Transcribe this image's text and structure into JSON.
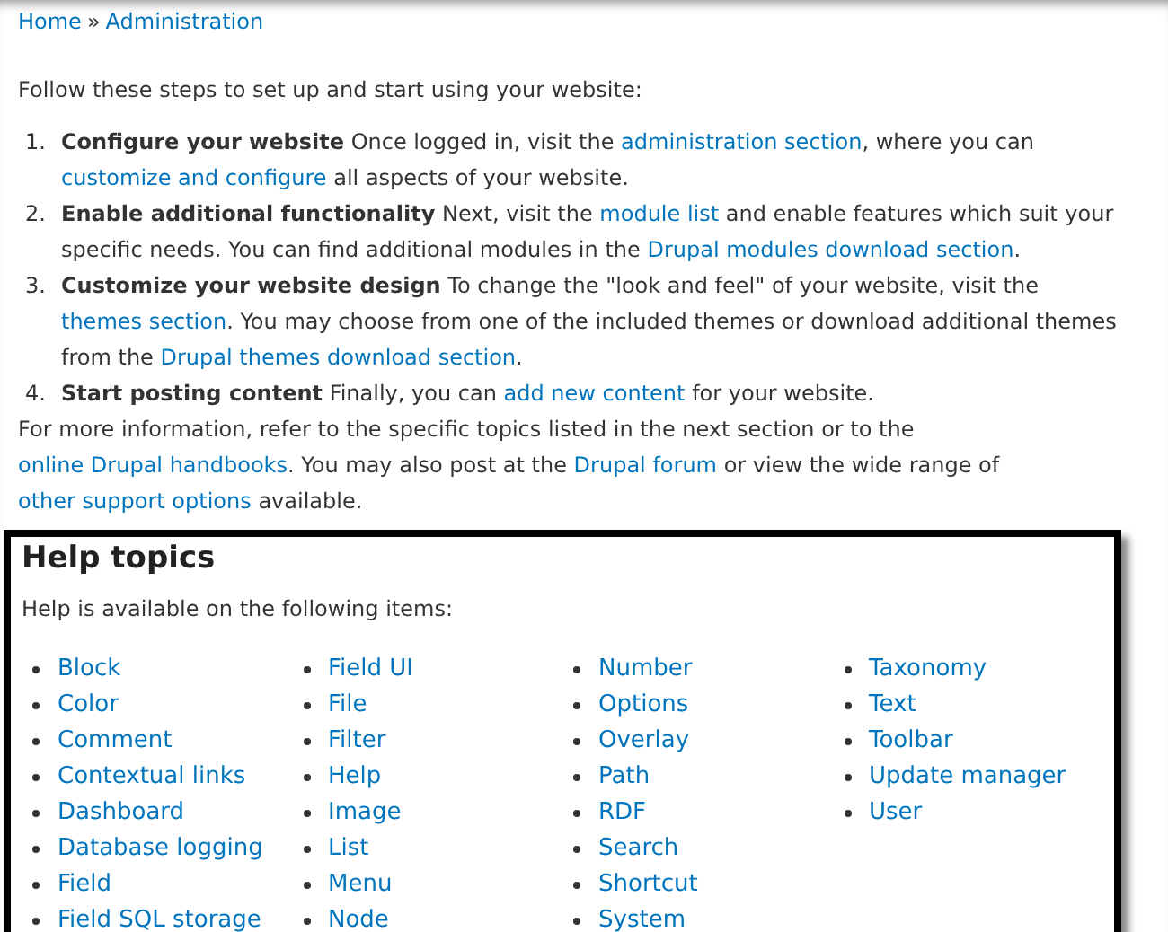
{
  "breadcrumb": [
    {
      "label": "Home",
      "kind": "link"
    },
    {
      "label": "»",
      "kind": "text"
    },
    {
      "label": "Administration",
      "kind": "link"
    }
  ],
  "intro": "Follow these steps to set up and start using your website:",
  "steps": [
    {
      "number": "1.",
      "segments": [
        {
          "kind": "bold",
          "text": "Configure your website"
        },
        {
          "kind": "text",
          "text": " Once logged in, visit the "
        },
        {
          "kind": "link",
          "text": "administration section"
        },
        {
          "kind": "text",
          "text": ", where you can "
        },
        {
          "kind": "link",
          "text": "customize and configure"
        },
        {
          "kind": "text",
          "text": " all aspects of your website."
        }
      ]
    },
    {
      "number": "2.",
      "segments": [
        {
          "kind": "bold",
          "text": "Enable additional functionality"
        },
        {
          "kind": "text",
          "text": " Next, visit the "
        },
        {
          "kind": "link",
          "text": "module list"
        },
        {
          "kind": "text",
          "text": " and enable features which suit your specific needs. You can find additional modules in the "
        },
        {
          "kind": "link",
          "text": "Drupal modules download section"
        },
        {
          "kind": "text",
          "text": "."
        }
      ]
    },
    {
      "number": "3.",
      "segments": [
        {
          "kind": "bold",
          "text": "Customize your website design"
        },
        {
          "kind": "text",
          "text": " To change the \"look and feel\" of your website, visit the "
        },
        {
          "kind": "link",
          "text": "themes section"
        },
        {
          "kind": "text",
          "text": ". You may choose from one of the included themes or download additional themes from the "
        },
        {
          "kind": "link",
          "text": "Drupal themes download section"
        },
        {
          "kind": "text",
          "text": "."
        }
      ]
    },
    {
      "number": "4.",
      "segments": [
        {
          "kind": "bold",
          "text": "Start posting content"
        },
        {
          "kind": "text",
          "text": " Finally, you can "
        },
        {
          "kind": "link",
          "text": "add new content"
        },
        {
          "kind": "text",
          "text": " for your website."
        }
      ]
    }
  ],
  "more_info": [
    {
      "kind": "text",
      "text": "For more information, refer to the specific topics listed in the next section or to the "
    },
    {
      "kind": "link",
      "text": "online Drupal handbooks"
    },
    {
      "kind": "text",
      "text": ". You may also post at the "
    },
    {
      "kind": "link",
      "text": "Drupal forum"
    },
    {
      "kind": "text",
      "text": " or view the wide range of "
    },
    {
      "kind": "link",
      "text": "other support options"
    },
    {
      "kind": "text",
      "text": " available."
    }
  ],
  "help_topics": {
    "title": "Help topics",
    "description": "Help is available on the following items:",
    "columns": [
      [
        "Block",
        "Color",
        "Comment",
        "Contextual links",
        "Dashboard",
        "Database logging",
        "Field",
        "Field SQL storage"
      ],
      [
        "Field UI",
        "File",
        "Filter",
        "Help",
        "Image",
        "List",
        "Menu",
        "Node"
      ],
      [
        "Number",
        "Options",
        "Overlay",
        "Path",
        "RDF",
        "Search",
        "Shortcut",
        "System"
      ],
      [
        "Taxonomy",
        "Text",
        "Toolbar",
        "Update manager",
        "User"
      ]
    ]
  }
}
